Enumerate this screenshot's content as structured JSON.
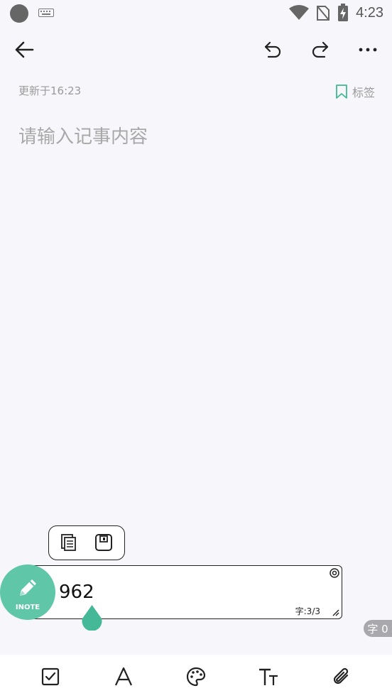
{
  "status_bar": {
    "time": "4:23",
    "icons": [
      "circle-indicator",
      "keyboard-icon",
      "wifi-icon",
      "no-sim-icon",
      "battery-charging-icon"
    ]
  },
  "app_bar": {
    "icons": [
      "back-arrow-icon",
      "undo-icon",
      "redo-icon",
      "more-icon"
    ]
  },
  "meta": {
    "updated": "更新于16:23",
    "tag_label": "标签",
    "tag_icon": "bookmark-icon",
    "accent_color": "#3fb98f"
  },
  "editor": {
    "placeholder": "请输入记事内容"
  },
  "floating_input": {
    "value": "962",
    "word_count": "字:3/3",
    "logo_text": "INOTE",
    "logo_color": "#5fc6a8",
    "mini_toolbar_icons": [
      "copy-icon",
      "save-icon"
    ]
  },
  "word_badge": "字 0",
  "bottom_toolbar": {
    "icons": [
      "checkbox-icon",
      "font-icon",
      "palette-icon",
      "text-size-icon",
      "attachment-icon"
    ]
  }
}
